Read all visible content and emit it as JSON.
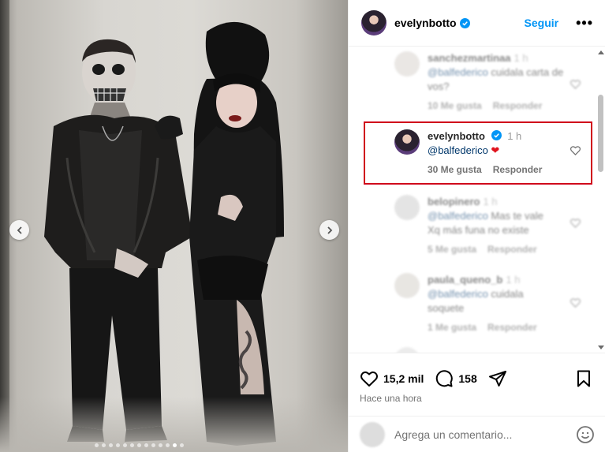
{
  "header": {
    "username": "evelynbotto",
    "follow_label": "Seguir",
    "more_label": "•••"
  },
  "comments": [
    {
      "username": "sanchezmartinaa",
      "time": "1 h",
      "mention": "@balfederico",
      "text": "cuidala carta de vos?",
      "likes": "10 Me gusta",
      "reply": "Responder"
    },
    {
      "username": "evelynbotto",
      "time": "1 h",
      "mention": "@balfederico",
      "text": "❤",
      "likes": "30 Me gusta",
      "reply": "Responder"
    },
    {
      "username": "belopinero",
      "time": "1 h",
      "mention": "@balfederico",
      "text": "Mas te vale",
      "text2": "Xq más funa no existe",
      "likes": "5 Me gusta",
      "reply": "Responder"
    },
    {
      "username": "paula_queno_b",
      "time": "1 h",
      "mention": "@balfederico",
      "text": "cuidala",
      "text2": "soquete",
      "likes": "1 Me gusta",
      "reply": "Responder"
    }
  ],
  "actions": {
    "likes": "15,2 mil",
    "comments": "158",
    "timestamp": "Hace una hora"
  },
  "add_comment": {
    "placeholder": "Agrega un comentario..."
  },
  "colors": {
    "accent": "#0095f6",
    "highlight": "#d0021b",
    "heart": "#e0141e"
  },
  "carousel": {
    "active_index": 11,
    "total": 13
  }
}
